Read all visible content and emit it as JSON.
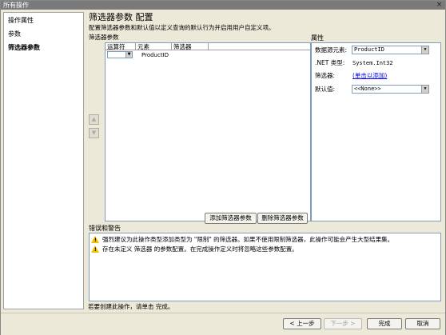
{
  "window": {
    "title": "所有操作",
    "close_glyph": "×"
  },
  "nav": {
    "items": [
      {
        "label": "操作属性",
        "active": false
      },
      {
        "label": "参数",
        "active": false
      },
      {
        "label": "筛选器参数",
        "active": true
      }
    ]
  },
  "header": {
    "title": "筛选器参数 配置",
    "description": "配置筛选器参数和默认值以定义查询的默认行为并启用用户自定义项。"
  },
  "filter_params": {
    "label": "筛选器参数",
    "columns": [
      "运算符",
      "元素",
      "筛选器"
    ],
    "rows": [
      {
        "operator": "",
        "element": "ProductID",
        "filter": ""
      }
    ],
    "move_up_glyph": "▲",
    "move_down_glyph": "▼",
    "add_button": "添加筛选器参数",
    "delete_button": "删除筛选器参数"
  },
  "properties": {
    "title": "属性",
    "datasource_label": "数据源元素:",
    "datasource_value": "ProductID",
    "nettype_label": ".NET 类型:",
    "nettype_value": "System.Int32",
    "filter_label": "筛选器:",
    "filter_link": "(单击以添加)",
    "default_label": "默认值:",
    "default_value": "<<None>>"
  },
  "errors": {
    "title": "错误和警告",
    "messages": [
      "强烈建议为此操作类型添加类型为 \"限制\" 的筛选器。如果不使用限制筛选器，此操作可能会产生大型结果集。",
      "存在未定义 筛选器 的参数配置。在完成操作定义时将忽略这些参数配置。"
    ]
  },
  "footer": {
    "instruction": "若要创建此操作，请单击 完成。",
    "prev_button": "< 上一步",
    "next_button": "下一步 >",
    "finish_button": "完成",
    "cancel_button": "取消"
  },
  "icons": {
    "dropdown": "chevron-down-icon",
    "warning": "warning-icon",
    "close": "close-icon"
  },
  "colors": {
    "titlebar": "#7a7a7a",
    "window_bg": "#ece9d8",
    "link": "#0000ff",
    "warning": "#f2c200"
  }
}
